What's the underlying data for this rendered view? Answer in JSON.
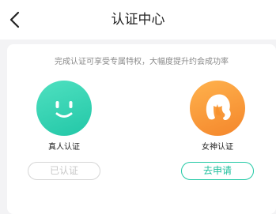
{
  "header": {
    "title": "认证中心",
    "back_icon": "chevron-left-icon"
  },
  "card": {
    "subtitle": "完成认证可享受专属特权，大幅度提升约会成功率"
  },
  "verifications": [
    {
      "name": "真人认证",
      "icon": "smiley-face-icon",
      "color": "#2dd4b1",
      "action_label": "已认证",
      "status": "verified"
    },
    {
      "name": "女神认证",
      "icon": "woman-hair-icon",
      "color": "#f7922f",
      "action_label": "去申请",
      "status": "not-applied"
    }
  ],
  "colors": {
    "accent": "#22c9a5",
    "disabled": "#c8c8c8"
  }
}
